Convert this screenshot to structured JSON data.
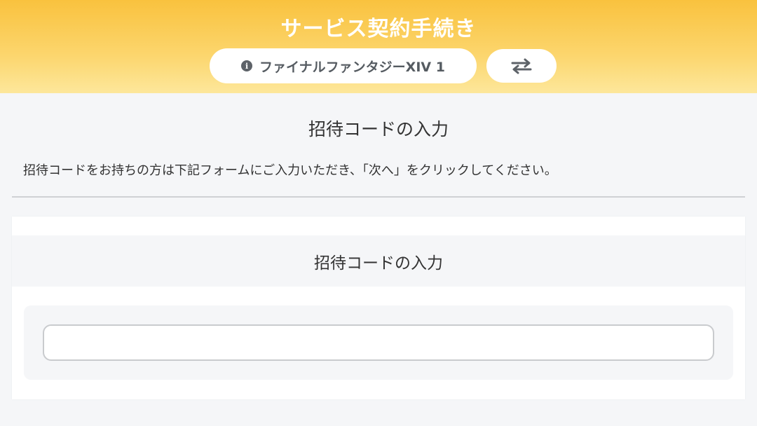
{
  "header": {
    "title": "サービス契約手続き",
    "service_name": "ファイナルファンタジーXIV 1",
    "info_icon_glyph": "i",
    "switch_icon": "swap-arrows-icon",
    "gradient_top": "#f9c23e",
    "gradient_bottom": "#fde79b"
  },
  "main": {
    "heading": "招待コードの入力",
    "instruction": "招待コードをお持ちの方は下記フォームにご入力いただき、「次へ」をクリックしてください。",
    "card": {
      "title": "招待コードの入力",
      "input_value": "",
      "input_placeholder": ""
    }
  }
}
